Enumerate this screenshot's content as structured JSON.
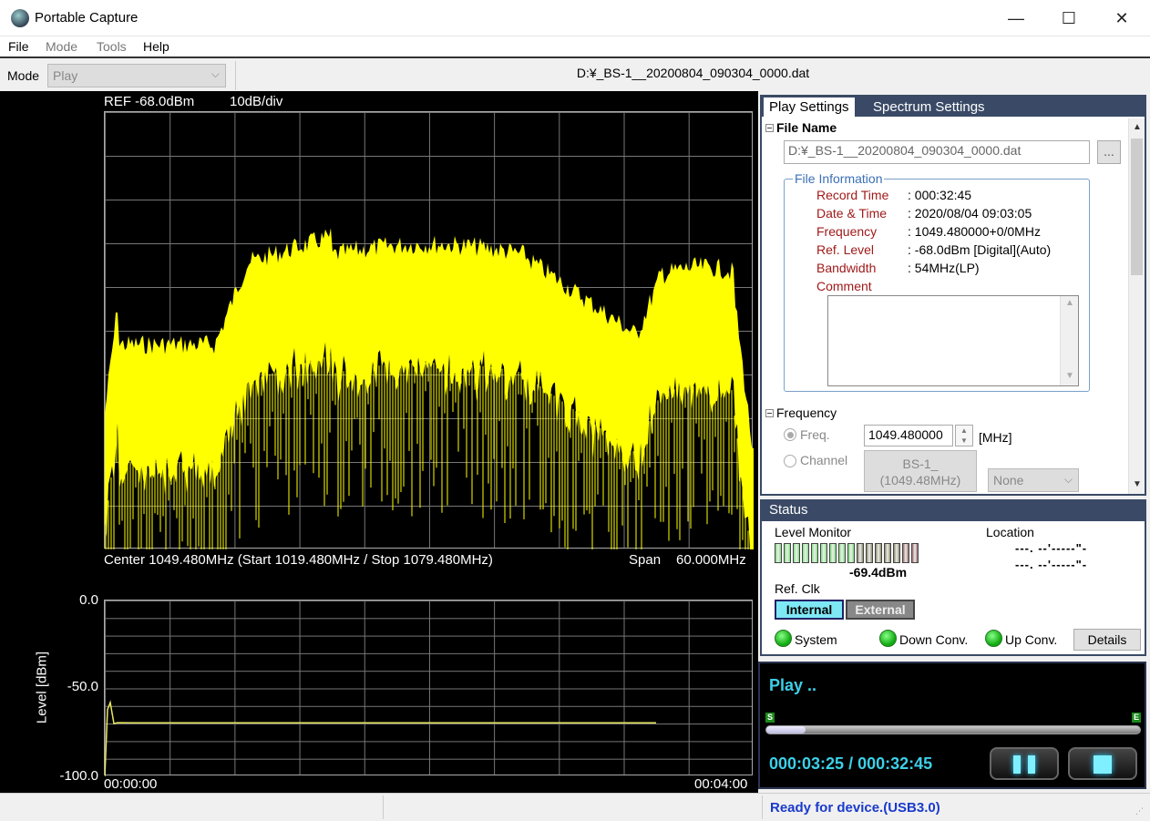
{
  "window": {
    "title": "Portable Capture",
    "minimize": "—",
    "maximize": "☐",
    "close": "✕"
  },
  "menu": {
    "file": "File",
    "mode": "Mode",
    "tools": "Tools",
    "help": "Help"
  },
  "modebar": {
    "label": "Mode",
    "value": "Play",
    "filepath": "D:¥_BS-1__20200804_090304_0000.dat"
  },
  "spectrum": {
    "ref": "REF -68.0dBm",
    "scale": "10dB/div",
    "center": "Center 1049.480MHz (Start 1019.480MHz / Stop 1079.480MHz)",
    "span": "Span",
    "span_value": "60.000MHz",
    "trace_color": "#ffff00"
  },
  "level_plot": {
    "ylabel": "Level [dBm]",
    "y_ticks": [
      "0.0",
      "-50.0",
      "-100.0"
    ],
    "x_start": "00:00:00",
    "x_end": "00:04:00",
    "trace_color": "#e8e860"
  },
  "settings": {
    "tabs": [
      "Play Settings",
      "Spectrum Settings"
    ],
    "file_name_head": "File Name",
    "file_name_value": "D:¥_BS-1__20200804_090304_0000.dat",
    "browse": "...",
    "file_info_title": "File Information",
    "info": [
      {
        "key": "Record Time",
        "value": ": 000:32:45"
      },
      {
        "key": "Date & Time",
        "value": ": 2020/08/04 09:03:05"
      },
      {
        "key": "Frequency",
        "value": ": 1049.480000+0/0MHz"
      },
      {
        "key": "Ref. Level",
        "value": ": -68.0dBm [Digital](Auto)"
      },
      {
        "key": "Bandwidth",
        "value": ": 54MHz(LP)"
      },
      {
        "key": "Comment",
        "value": ""
      }
    ],
    "frequency_head": "Frequency",
    "freq_label": "Freq.",
    "freq_value": "1049.480000",
    "freq_unit": "[MHz]",
    "channel_label": "Channel",
    "channel_value_1": "BS-1_",
    "channel_value_2": "(1049.48MHz)",
    "channel_select": "None"
  },
  "status": {
    "head": "Status",
    "level_monitor": "Level Monitor",
    "level_value": "-69.4dBm",
    "location": "Location",
    "location_line1": "---. --'-----\"-",
    "location_line2": "---. --'-----\"-",
    "ref_clk": "Ref. Clk",
    "internal": "Internal",
    "external": "External",
    "system": "System",
    "down_conv": "Down Conv.",
    "up_conv": "Up Conv.",
    "details": "Details",
    "led_active_color": "#7ee07e",
    "led_inactive_color": "#8a8a6a"
  },
  "player": {
    "state": "Play ..",
    "start_marker": "S",
    "end_marker": "E",
    "time": "000:03:25 / 000:32:45",
    "progress": 0.104,
    "accent": "#3cd0e8"
  },
  "statusbar": {
    "message": "Ready for device.(USB3.0)"
  }
}
